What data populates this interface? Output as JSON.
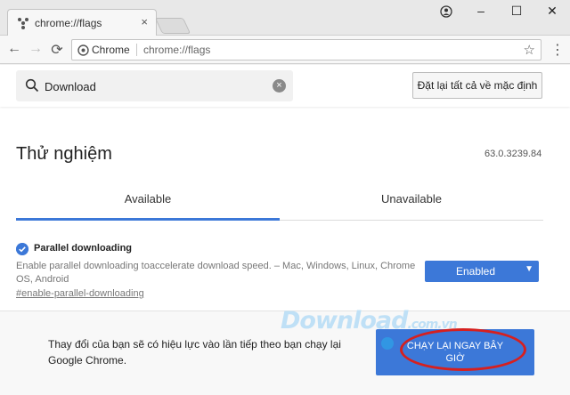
{
  "tab": {
    "title": "chrome://flags",
    "close": "×"
  },
  "window": {
    "minimize": "–",
    "maximize": "☐",
    "close": "✕"
  },
  "toolbar": {
    "back": "←",
    "forward": "→",
    "reload": "⟳",
    "chip": "Chrome",
    "url": "chrome://flags",
    "star": "☆",
    "menu": "⋮"
  },
  "search": {
    "value": "Download",
    "clear": "×"
  },
  "reset_button": "Đặt lại tất cả về mặc định",
  "heading": "Thử nghiệm",
  "version": "63.0.3239.84",
  "tabs": {
    "available": "Available",
    "unavailable": "Unavailable"
  },
  "flag": {
    "title": "Parallel downloading",
    "description": "Enable parallel downloading toaccelerate download speed. – Mac, Windows, Linux, Chrome OS, Android",
    "link": "#enable-parallel-downloading",
    "selected": "Enabled",
    "caret": "▼"
  },
  "relaunch": {
    "message": "Thay đổi của bạn sẽ có hiệu lực vào lần tiếp theo bạn chạy lại Google Chrome.",
    "button": "CHẠY LẠI NGAY BÂY GIỜ"
  },
  "watermark": {
    "main": "Download",
    "suffix": ".com.vn"
  },
  "colors": {
    "accent": "#3c78d8",
    "annotation": "#d6201f"
  }
}
